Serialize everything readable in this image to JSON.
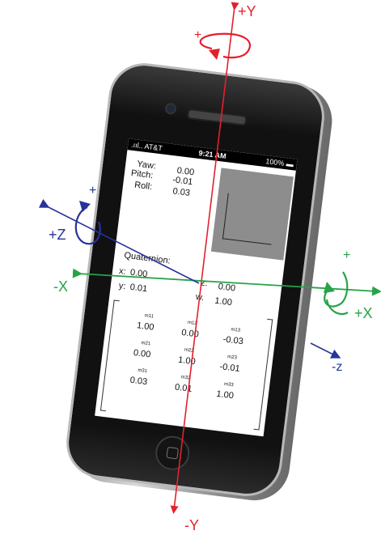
{
  "axes": {
    "plus_y": "+Y",
    "minus_y": "-Y",
    "plus_x": "+X",
    "minus_x": "-X",
    "plus_z": "+Z",
    "minus_z": "-z",
    "rot_plus": "+",
    "colors": {
      "y": "#e3212b",
      "x": "#27a348",
      "z": "#26339a"
    }
  },
  "status_bar": {
    "carrier": ".ııl.. AT&T",
    "time": "9:21 AM",
    "battery": "100%"
  },
  "attitude": {
    "yaw_label": "Yaw:",
    "yaw_value": "0.00",
    "pitch_label": "Pitch:",
    "pitch_value": "-0.01",
    "roll_label": "Roll:",
    "roll_value": "0.03"
  },
  "quaternion": {
    "title": "Quaternion:",
    "x_label": "x:",
    "x_value": "0.00",
    "y_label": "y:",
    "y_value": "0.01",
    "z_label": "z:",
    "z_value": "0.00",
    "w_label": "w.",
    "w_value": "1.00"
  },
  "matrix": {
    "m11": {
      "label": "m11",
      "value": "1.00"
    },
    "m12": {
      "label": "m12",
      "value": "0.00"
    },
    "m13": {
      "label": "m13",
      "value": "-0.03"
    },
    "m21": {
      "label": "m21",
      "value": "0.00"
    },
    "m22": {
      "label": "m22",
      "value": "1.00"
    },
    "m23": {
      "label": "m23",
      "value": "-0.01"
    },
    "m31": {
      "label": "m31",
      "value": "0.03"
    },
    "m32": {
      "label": "m32",
      "value": "0.01"
    },
    "m33": {
      "label": "m33",
      "value": "1.00"
    }
  }
}
